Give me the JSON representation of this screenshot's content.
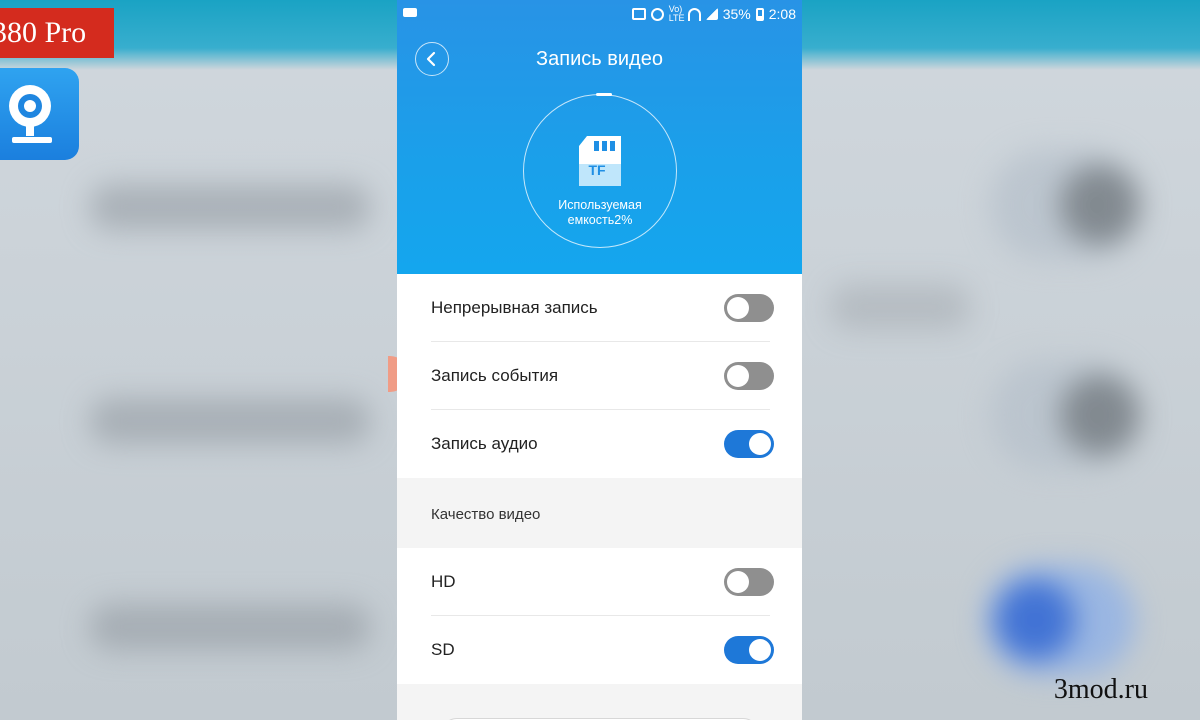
{
  "overlay": {
    "app_name_fragment": "380 Pro",
    "watermark": "3mod.ru"
  },
  "statusbar": {
    "battery_percent": "35%",
    "time": "2:08",
    "network": "Vo) LTE"
  },
  "header": {
    "title": "Запись видео",
    "storage_icon_text": "TF",
    "usage_line1": "Используемая",
    "usage_line2": "емкость2%",
    "usage_fraction": 0.02
  },
  "settings": {
    "rows": [
      {
        "label": "Непрерывная запись",
        "enabled": false
      },
      {
        "label": "Запись события",
        "enabled": false
      },
      {
        "label": "Запись аудио",
        "enabled": true
      }
    ],
    "quality_section": "Качество видео",
    "quality_rows": [
      {
        "label": "HD",
        "enabled": false
      },
      {
        "label": "SD",
        "enabled": true
      }
    ]
  },
  "colors": {
    "header_blue": "#1aa0ea",
    "toggle_on": "#1e78d8",
    "toggle_off": "#8f8f8f",
    "overlay_red": "#d42b1e"
  }
}
